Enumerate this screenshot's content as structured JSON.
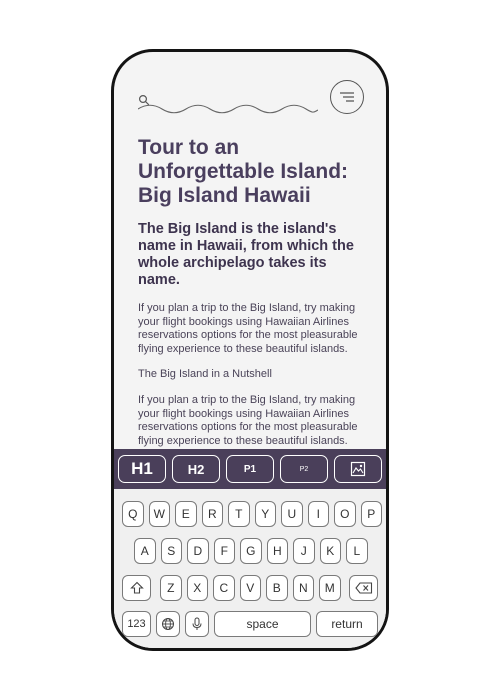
{
  "article": {
    "title": "Tour to an Unforgettable Island: Big Island Hawaii",
    "lead": "The Big Island is the island's name in Hawaii, from which the whole archipelago takes its name.",
    "paragraph1": "If you plan a trip to the Big Island, try making your flight bookings using Hawaiian Airlines reservations options for the most pleasurable flying experience to these beautiful islands.",
    "section_label": "The Big Island in a Nutshell",
    "paragraph2": "If you plan a trip to the Big Island, try making your flight bookings using Hawaiian Airlines reservations options for the most pleasurable flying experience to these beautiful islands."
  },
  "format_bar": {
    "h1": "H1",
    "h2": "H2",
    "p1": "P1",
    "p2": "P2"
  },
  "keyboard": {
    "row1": [
      "Q",
      "W",
      "E",
      "R",
      "T",
      "Y",
      "U",
      "I",
      "O",
      "P"
    ],
    "row2": [
      "A",
      "S",
      "D",
      "F",
      "G",
      "H",
      "J",
      "K",
      "L"
    ],
    "row3": [
      "Z",
      "X",
      "C",
      "V",
      "B",
      "N",
      "M"
    ],
    "numbers": "123",
    "space": "space",
    "return": "return"
  },
  "icons": {
    "search": "search-icon",
    "menu": "menu-icon",
    "image": "image-icon",
    "shift": "shift-icon",
    "backspace": "backspace-icon",
    "globe": "globe-icon",
    "mic": "microphone-icon"
  },
  "colors": {
    "accent": "#4a3f5a",
    "text": "#473e58",
    "frame": "#141414"
  }
}
